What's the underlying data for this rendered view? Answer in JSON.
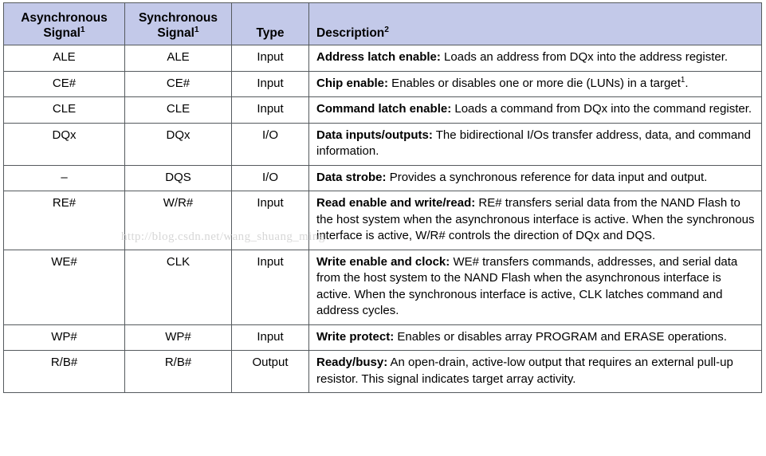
{
  "table": {
    "name": "nand-flash-signal-descriptions",
    "columns": [
      {
        "id": "async",
        "label": "Asynchronous",
        "label_line2": "Signal",
        "superscript": "1",
        "align": "center"
      },
      {
        "id": "sync",
        "label": "Synchronous",
        "label_line2": "Signal",
        "superscript": "1",
        "align": "center"
      },
      {
        "id": "type",
        "label": "Type",
        "label_line2": "",
        "superscript": "",
        "align": "center"
      },
      {
        "id": "desc",
        "label": "Description",
        "label_line2": "",
        "superscript": "2",
        "align": "left"
      }
    ],
    "header_background": "#c3c9e9",
    "border_color": "#555a5e",
    "rows": [
      {
        "async": "ALE",
        "sync": "ALE",
        "type": "Input",
        "desc_lead": "Address latch enable:",
        "desc_body": " Loads an address from DQx into the address register."
      },
      {
        "async": "CE#",
        "sync": "CE#",
        "type": "Input",
        "desc_lead": "Chip enable:",
        "desc_body": " Enables or disables one or more die (LUNs) in a target",
        "desc_sup": "1",
        "desc_tail": "."
      },
      {
        "async": "CLE",
        "sync": "CLE",
        "type": "Input",
        "desc_lead": "Command latch enable:",
        "desc_body": " Loads a command from DQx into the command register."
      },
      {
        "async": "DQx",
        "sync": "DQx",
        "type": "I/O",
        "desc_lead": "Data inputs/outputs:",
        "desc_body": " The bidirectional I/Os transfer address, data, and command information."
      },
      {
        "async": "–",
        "sync": "DQS",
        "type": "I/O",
        "desc_lead": "Data strobe:",
        "desc_body": " Provides a synchronous reference for data input and output."
      },
      {
        "async": "RE#",
        "sync": "W/R#",
        "type": "Input",
        "desc_lead": "Read enable and write/read:",
        "desc_body": " RE# transfers serial data from the NAND Flash to the host system when the asynchronous interface is active. When the synchronous interface is active, W/R# controls the direction of DQx and DQS."
      },
      {
        "async": "WE#",
        "sync": "CLK",
        "type": "Input",
        "desc_lead": "Write enable and clock:",
        "desc_body": " WE# transfers commands, addresses, and serial data from the host system to the NAND Flash when the asynchronous interface is active. When the synchronous interface is active, CLK latches command and address cycles."
      },
      {
        "async": "WP#",
        "sync": "WP#",
        "type": "Input",
        "desc_lead": "Write protect:",
        "desc_body": " Enables or disables array PROGRAM and ERASE operations."
      },
      {
        "async": "R/B#",
        "sync": "R/B#",
        "type": "Output",
        "desc_lead": "Ready/busy:",
        "desc_body": " An open-drain, active-low output that requires an external pull-up resistor. This signal indicates target array activity."
      }
    ]
  },
  "watermark": {
    "text": "http://blog.csdn.net/wang_shuang_ming"
  }
}
